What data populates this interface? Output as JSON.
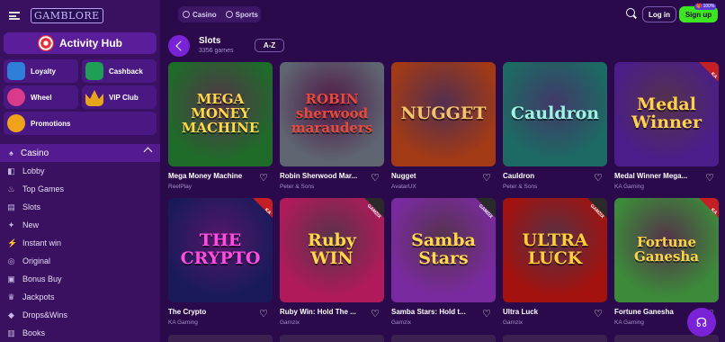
{
  "header": {
    "logo_text": "GAMBLORE",
    "tabs": [
      {
        "label": "Casino",
        "icon": "casino-chip-icon"
      },
      {
        "label": "Sports",
        "icon": "soccer-ball-icon"
      }
    ],
    "login_label": "Log in",
    "signup_label": "Sign up",
    "signup_badge": "🎁 100%"
  },
  "sidebar": {
    "activity_hub": "Activity Hub",
    "tiles": [
      {
        "label": "Loyalty",
        "icon": "shield-icon",
        "color": "#2f7fd9"
      },
      {
        "label": "Cashback",
        "icon": "cash-icon",
        "color": "#1f9e55"
      },
      {
        "label": "Wheel",
        "icon": "wheel-icon",
        "color": "#d93a8a"
      },
      {
        "label": "VIP Club",
        "icon": "crown-icon",
        "color": "#e8a51c"
      },
      {
        "label": "Promotions",
        "icon": "percent-icon",
        "color": "#f0a21a"
      }
    ],
    "casino_label": "Casino",
    "items": [
      {
        "label": "Lobby",
        "icon": "lobby-icon"
      },
      {
        "label": "Top Games",
        "icon": "flame-icon"
      },
      {
        "label": "Slots",
        "icon": "slots-icon"
      },
      {
        "label": "New",
        "icon": "new-icon"
      },
      {
        "label": "Instant win",
        "icon": "instant-icon"
      },
      {
        "label": "Original",
        "icon": "original-icon"
      },
      {
        "label": "Bonus Buy",
        "icon": "bonus-buy-icon"
      },
      {
        "label": "Jackpots",
        "icon": "jackpot-icon"
      },
      {
        "label": "Drops&Wins",
        "icon": "drops-icon"
      },
      {
        "label": "Books",
        "icon": "book-icon"
      }
    ]
  },
  "main": {
    "title": "Slots",
    "count": "3356 games",
    "sort_label": "A-Z"
  },
  "games": [
    {
      "name": "Mega Money Machine",
      "provider": "ReelPlay",
      "art": "MEGA MONEY MACHINE",
      "bg": "#1f6b2a",
      "fg": "#ffd84a",
      "badge": ""
    },
    {
      "name": "Robin Sherwood Mar...",
      "provider": "Peter & Sons",
      "art": "ROBIN sherwood marauders",
      "bg": "#5e6470",
      "fg": "#e84a3a",
      "badge": ""
    },
    {
      "name": "Nugget",
      "provider": "AvatarUX",
      "art": "NUGGET",
      "bg": "#a23a16",
      "fg": "#f3c46a",
      "badge": ""
    },
    {
      "name": "Cauldron",
      "provider": "Peter & Sons",
      "art": "Cauldron",
      "bg": "#1c6a63",
      "fg": "#9ff3e3",
      "badge": ""
    },
    {
      "name": "Medal Winner Mega...",
      "provider": "KA Gaming",
      "art": "Medal Winner",
      "bg": "#4a1d8a",
      "fg": "#ffd24a",
      "badge": "KA"
    },
    {
      "name": "The Crypto",
      "provider": "KA Gaming",
      "art": "THE CRYPTO",
      "bg": "#1a1a5a",
      "fg": "#ff4de0",
      "badge": "KA"
    },
    {
      "name": "Ruby Win: Hold The ...",
      "provider": "Gamzix",
      "art": "Ruby WIN",
      "bg": "#b01a5a",
      "fg": "#ffd84a",
      "badge": "GAMZIX"
    },
    {
      "name": "Samba Stars: Hold t...",
      "provider": "Gamzix",
      "art": "Samba Stars",
      "bg": "#7a2aa0",
      "fg": "#ffd84a",
      "badge": "GAMZIX"
    },
    {
      "name": "Ultra Luck",
      "provider": "Gamzix",
      "art": "ULTRA LUCK",
      "bg": "#a3120e",
      "fg": "#ffcf3a",
      "badge": "GAMZIX"
    },
    {
      "name": "Fortune Ganesha",
      "provider": "KA Gaming",
      "art": "Fortune Ganesha",
      "bg": "#3c8a3a",
      "fg": "#ffd24a",
      "badge": "KA"
    }
  ]
}
